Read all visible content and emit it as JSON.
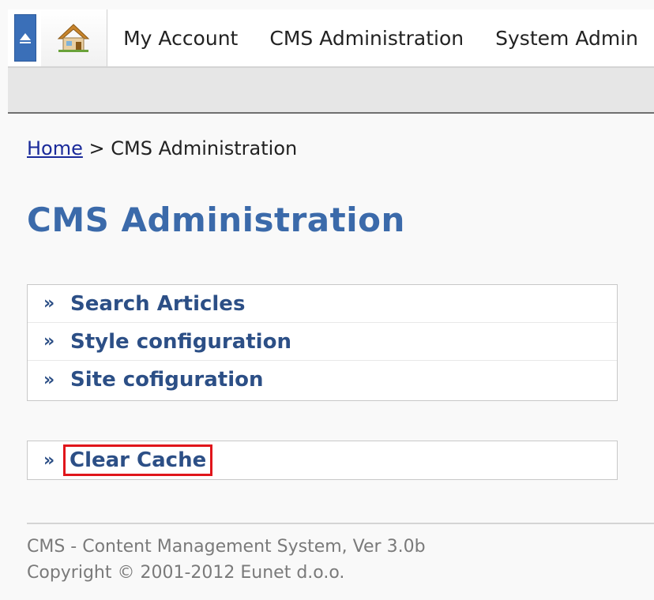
{
  "nav": {
    "items": [
      {
        "label": "My Account"
      },
      {
        "label": "CMS Administration"
      },
      {
        "label": "System Admin"
      }
    ]
  },
  "breadcrumb": {
    "home": "Home",
    "separator": ">",
    "current": "CMS Administration"
  },
  "page": {
    "title": "CMS Administration"
  },
  "menu": {
    "bullet": "»",
    "primary": [
      {
        "label": "Search Articles"
      },
      {
        "label": "Style configuration"
      },
      {
        "label": "Site cofiguration"
      }
    ],
    "secondary": [
      {
        "label": "Clear Cache"
      }
    ]
  },
  "footer": {
    "line1": "CMS - Content Management System, Ver 3.0b",
    "line2": "Copyright © 2001-2012 Eunet d.o.o."
  },
  "colors": {
    "accent": "#3b6aaa",
    "link": "#2c4f86",
    "highlight": "#e0151b"
  }
}
